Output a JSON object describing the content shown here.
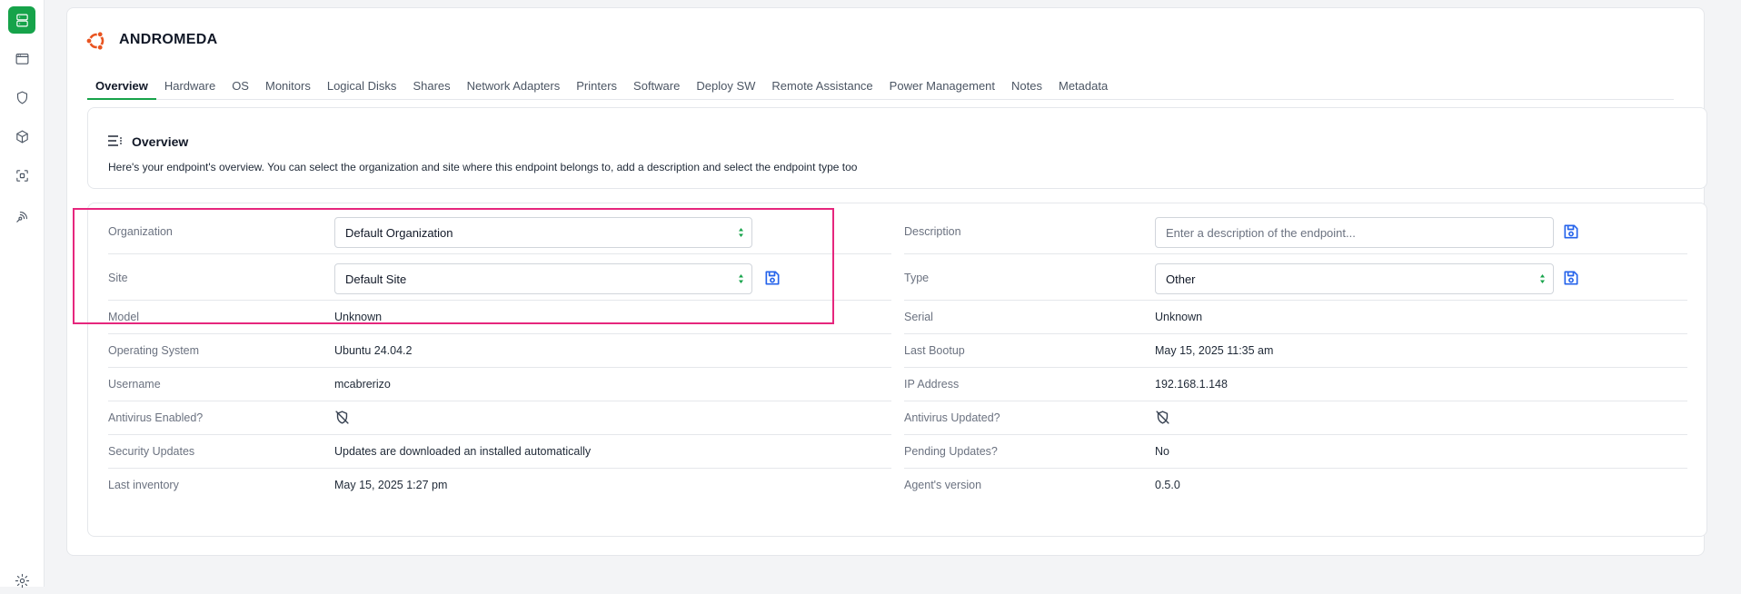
{
  "app": {
    "title": "ANDROMEDA"
  },
  "sidebar": {
    "items": [
      {
        "icon": "server-icon",
        "active": true
      },
      {
        "icon": "browser-window-icon",
        "active": false
      },
      {
        "icon": "shield-icon",
        "active": false
      },
      {
        "icon": "package-icon",
        "active": false
      },
      {
        "icon": "scan-icon",
        "active": false
      },
      {
        "icon": "remote-signal-icon",
        "active": false
      },
      {
        "icon": "gear-icon",
        "active": false
      }
    ]
  },
  "tabs": [
    "Overview",
    "Hardware",
    "OS",
    "Monitors",
    "Logical Disks",
    "Shares",
    "Network Adapters",
    "Printers",
    "Software",
    "Deploy SW",
    "Remote Assistance",
    "Power Management",
    "Notes",
    "Metadata"
  ],
  "overview": {
    "heading": "Overview",
    "description": "Here's your endpoint's overview. You can select the organization and site where this endpoint belongs to, add a description and select the endpoint type too"
  },
  "form": {
    "organization_label": "Organization",
    "organization_value": "Default Organization",
    "site_label": "Site",
    "site_value": "Default Site",
    "description_label": "Description",
    "description_placeholder": "Enter a description of the endpoint...",
    "type_label": "Type",
    "type_value": "Other"
  },
  "details": {
    "left": [
      {
        "label": "Model",
        "value": "Unknown"
      },
      {
        "label": "Operating System",
        "value": "Ubuntu 24.04.2"
      },
      {
        "label": "Username",
        "value": "mcabrerizo"
      },
      {
        "label": "Antivirus Enabled?",
        "value": "",
        "icon": "shield-off-icon"
      },
      {
        "label": "Security Updates",
        "value": "Updates are downloaded an installed automatically"
      },
      {
        "label": "Last inventory",
        "value": "May 15, 2025 1:27 pm"
      }
    ],
    "right": [
      {
        "label": "Serial",
        "value": "Unknown"
      },
      {
        "label": "Last Bootup",
        "value": "May 15, 2025 11:35 am"
      },
      {
        "label": "IP Address",
        "value": "192.168.1.148"
      },
      {
        "label": "Antivirus Updated?",
        "value": "",
        "icon": "shield-off-icon"
      },
      {
        "label": "Pending Updates?",
        "value": "No"
      },
      {
        "label": "Agent's version",
        "value": "0.5.0"
      }
    ]
  },
  "colors": {
    "accent": "#16a34a",
    "save_icon": "#2563eb",
    "highlight": "#e6267d",
    "logo": "#e95420"
  }
}
